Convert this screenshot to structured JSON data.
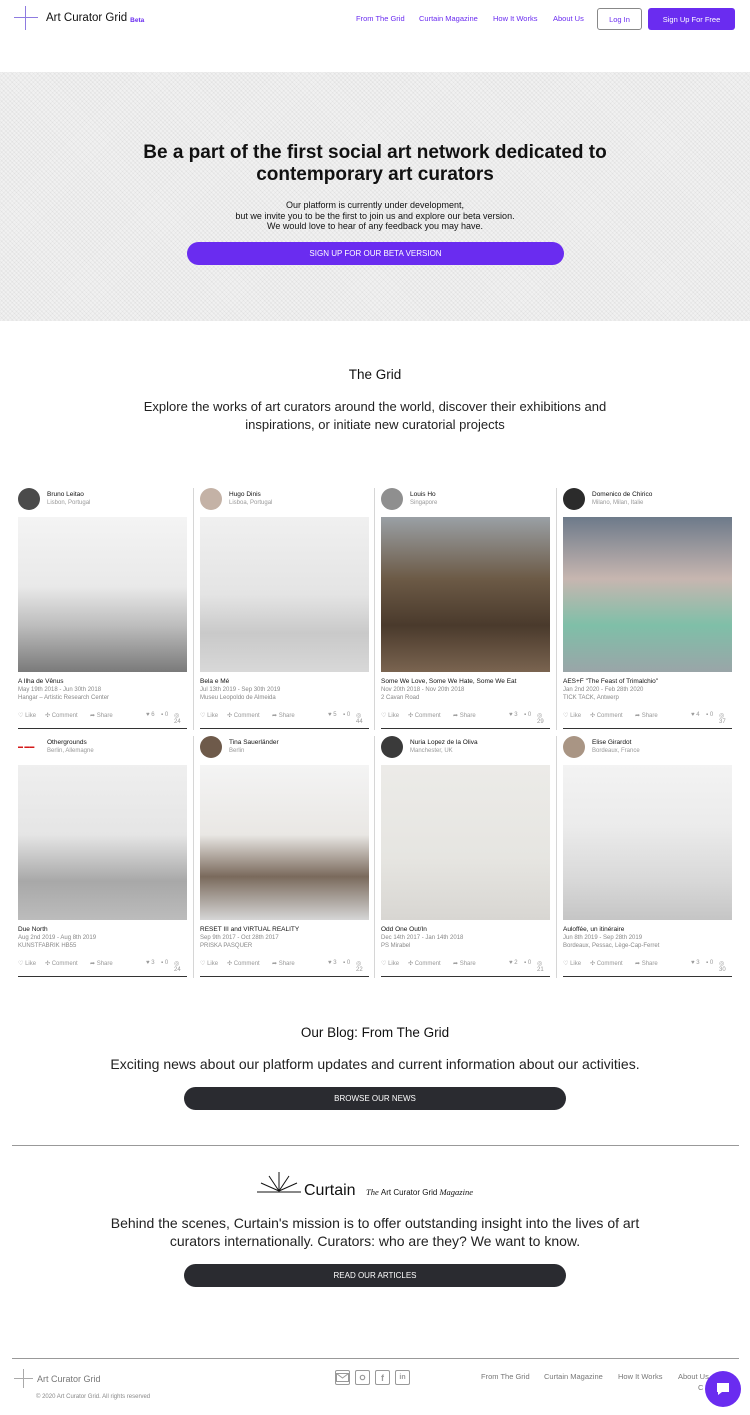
{
  "header": {
    "logo_text": "Art Curator Grid",
    "beta": "Beta",
    "nav": [
      "From The Grid",
      "Curtain Magazine",
      "How It Works",
      "About Us"
    ],
    "login": "Log In",
    "signup": "Sign Up For Free"
  },
  "hero": {
    "title_line1": "Be a part of the first social art network dedicated to",
    "title_line2": "contemporary art curators",
    "sub_line1": "Our platform is currently under development,",
    "sub_line2": "but we invite you to be the first to join us and explore our beta version.",
    "sub_line3": "We would love to hear of any feedback you may have.",
    "button": "SIGN UP FOR OUR BETA VERSION"
  },
  "grid": {
    "title": "The Grid",
    "sub_line1": "Explore the works of art curators around the world, discover their exhibitions and",
    "sub_line2": "inspirations, or initiate new curatorial projects",
    "actions": {
      "like": "Like",
      "comment": "Comment",
      "share": "Share"
    },
    "cards": [
      {
        "name": "Bruno Leitao",
        "location": "Lisbon, Portugal",
        "title": "A Ilha de Vênus",
        "dates": "May 19th 2018 - Jun 30th 2018",
        "venue": "Hangar – Artistic Research Center",
        "likes": "6",
        "comments": "0",
        "views": "24"
      },
      {
        "name": "Hugo Dinis",
        "location": "Lisboa, Portugal",
        "title": "Bela e Mé",
        "dates": "Jul 13th 2019 - Sep 30th 2019",
        "venue": "Museu Leopoldo de Almeida",
        "likes": "5",
        "comments": "0",
        "views": "44"
      },
      {
        "name": "Louis Ho",
        "location": "Singapore",
        "title": "Some We Love, Some We Hate, Some We Eat",
        "dates": "Nov 20th 2018 - Nov 20th 2018",
        "venue": "2 Cavan Road",
        "likes": "3",
        "comments": "0",
        "views": "29"
      },
      {
        "name": "Domenico de Chirico",
        "location": "Milano, Milan, Italie",
        "title": "AES+F \"The Feast of Trimalchio\"",
        "dates": "Jan 2nd 2020 - Feb 28th 2020",
        "venue": "TICK TACK, Antwerp",
        "likes": "4",
        "comments": "0",
        "views": "37"
      },
      {
        "name": "Othergrounds",
        "location": "Berlin, Allemagne",
        "title": "Due North",
        "dates": "Aug 2nd 2019 - Aug 8th 2019",
        "venue": "KUNSTFABRIK HB55",
        "likes": "3",
        "comments": "0",
        "views": "24"
      },
      {
        "name": "Tina Sauerländer",
        "location": "Berlin",
        "title": "RESET III and VIRTUAL REALITY",
        "dates": "Sep 9th 2017 - Oct 28th 2017",
        "venue": "PRISKA PASQUER",
        "likes": "3",
        "comments": "0",
        "views": "22"
      },
      {
        "name": "Nuria Lopez de la Oliva",
        "location": "Manchester, UK",
        "title": "Odd One Out/In",
        "dates": "Dec 14th 2017 - Jan 14th 2018",
        "venue": "PS Mirabel",
        "likes": "2",
        "comments": "0",
        "views": "21"
      },
      {
        "name": "Elise Girardot",
        "location": "Bordeaux, France",
        "title": "Auloffée, un itinéraire",
        "dates": "Jun 8th 2019 - Sep 28th 2019",
        "venue": "Bordeaux, Pessac, Lège-Cap-Ferret",
        "likes": "3",
        "comments": "0",
        "views": "30"
      }
    ]
  },
  "blog": {
    "title": "Our Blog: From The Grid",
    "sub": "Exciting news about our platform updates and current information about our activities.",
    "button": "BROWSE OUR NEWS"
  },
  "curtain": {
    "word": "Curtain",
    "tag_the": "The",
    "tag_name": "Art Curator Grid",
    "tag_mag": "Magazine",
    "sub_line1": "Behind the scenes, Curtain's mission is to offer outstanding insight into the lives of art",
    "sub_line2": "curators internationally. Curators: who are they? We want to know.",
    "button": "READ OUR ARTICLES"
  },
  "footer": {
    "logo_text": "Art Curator Grid",
    "copyright": "© 2020 Art Curator Grid. All rights reserved",
    "social": [
      "mail-icon",
      "instagram-icon",
      "facebook-icon",
      "linkedin-icon"
    ],
    "nav": [
      "From The Grid",
      "Curtain Magazine",
      "How It Works",
      "About Us"
    ],
    "extra": "C"
  }
}
